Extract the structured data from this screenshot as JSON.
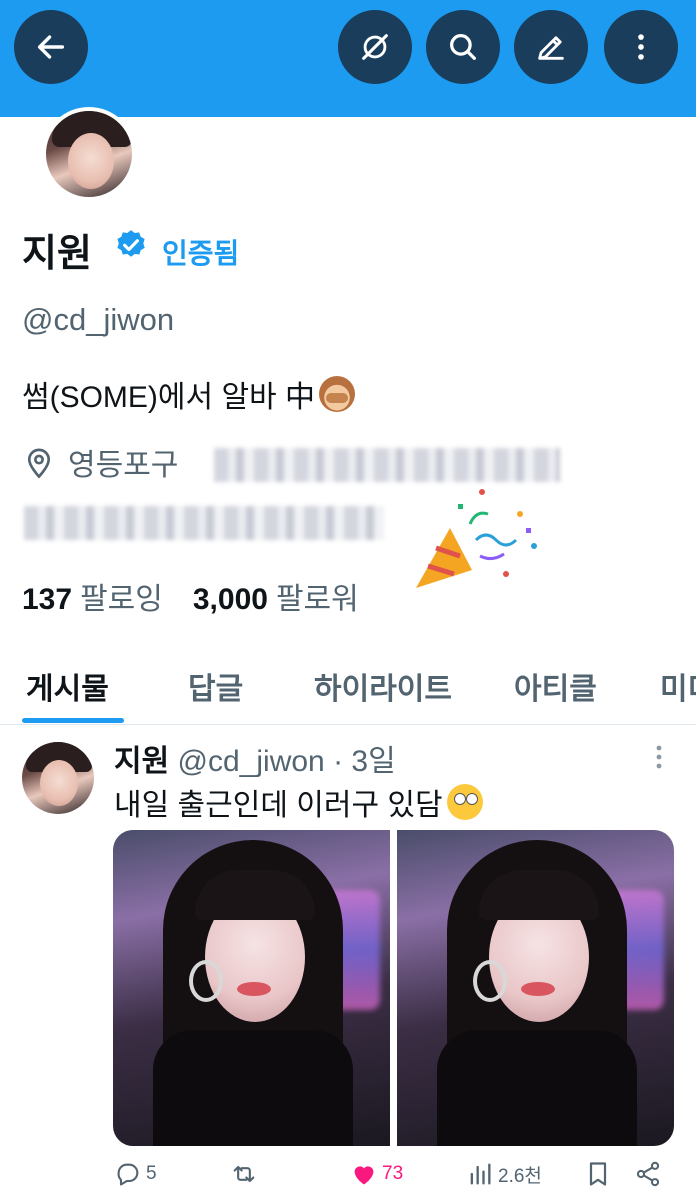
{
  "header": {
    "back_icon": "arrow-left-icon",
    "grok_icon": "grok-icon",
    "search_icon": "search-icon",
    "edit_icon": "pencil-icon",
    "more_icon": "kebab-icon",
    "banner_color": "#1d9bf0"
  },
  "profile": {
    "name": "지원",
    "verified_label": "인증됨",
    "handle": "@cd_jiwon",
    "bio": "썸(SOME)에서 알바 中",
    "location": "영등포구",
    "following_count": "137",
    "following_label": "팔로잉",
    "followers_count": "3,000",
    "followers_label": "팔로워"
  },
  "tabs": [
    {
      "label": "게시물",
      "active": true
    },
    {
      "label": "답글",
      "active": false
    },
    {
      "label": "하이라이트",
      "active": false
    },
    {
      "label": "아티클",
      "active": false
    },
    {
      "label": "미디",
      "active": false
    }
  ],
  "post": {
    "author_name": "지원",
    "author_handle": "@cd_jiwon",
    "separator": " · ",
    "age": "3일",
    "text": "내일 출근인데 이러구 있담",
    "replies": "5",
    "retweets": "",
    "likes": "73",
    "views": "2.6천",
    "like_color": "#f91880"
  }
}
